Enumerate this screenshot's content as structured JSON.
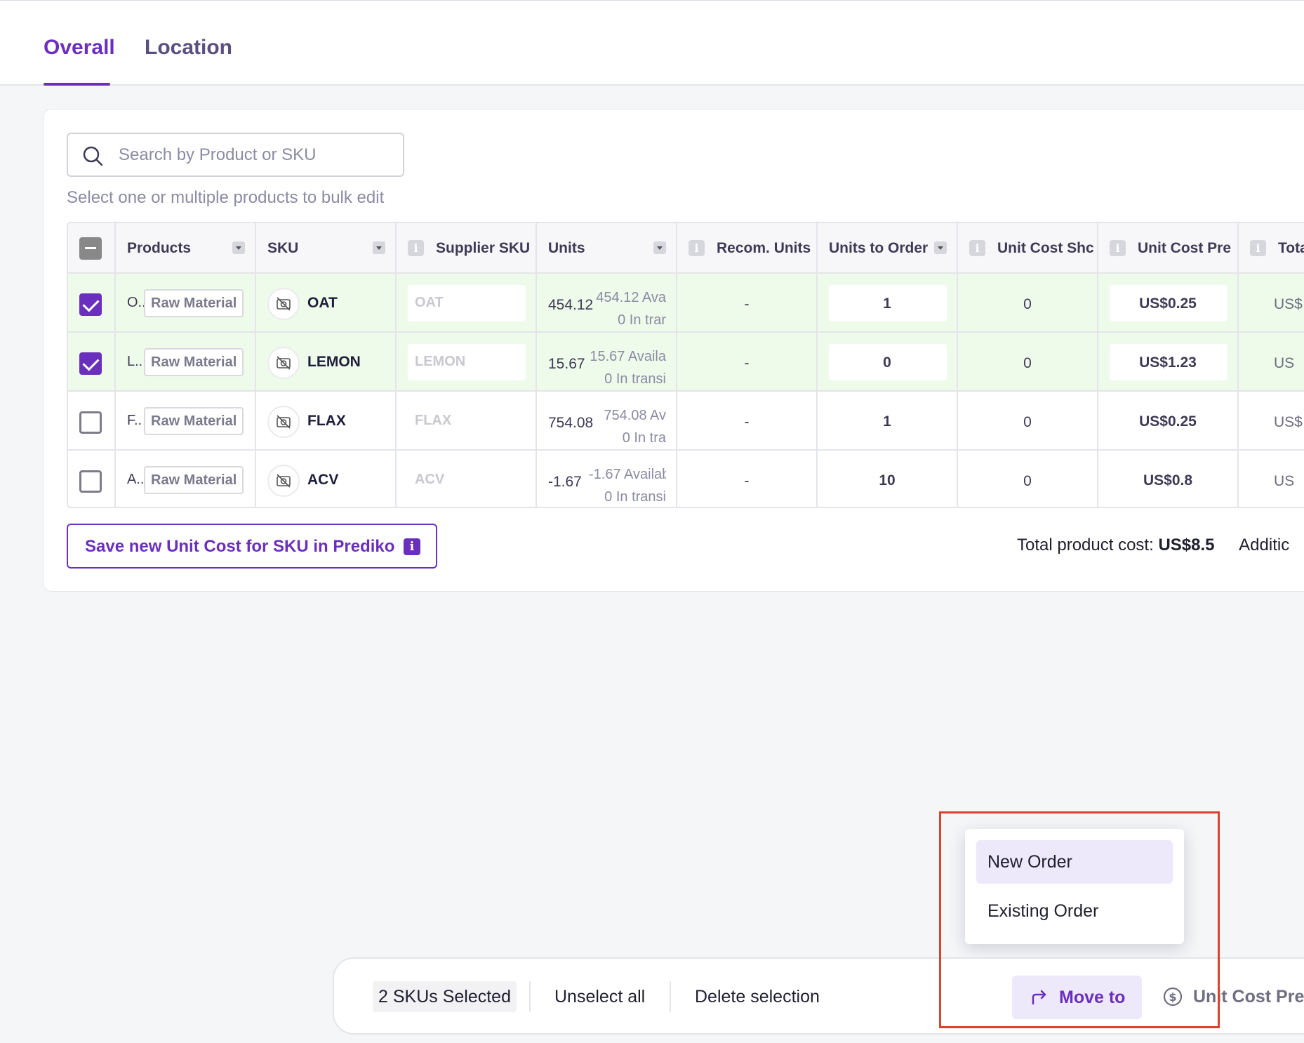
{
  "tabs": [
    {
      "label": "Overall",
      "active": true
    },
    {
      "label": "Location",
      "active": false
    }
  ],
  "search": {
    "placeholder": "Search by Product or SKU"
  },
  "hint": "Select one or multiple products to bulk edit",
  "columns": {
    "products": "Products",
    "sku": "SKU",
    "supplier_sku": "Supplier SKU",
    "units": "Units",
    "recom_units": "Recom. Units",
    "units_to_order": "Units to Order",
    "unit_cost_shopify": "Unit Cost Shc",
    "unit_cost_prediko": "Unit Cost Pre",
    "total": "Tota"
  },
  "rows": [
    {
      "selected": true,
      "initial": "O..",
      "tag": "Raw Material",
      "sku": "OAT",
      "supplier_sku": "OAT",
      "units": "454.12",
      "available": "454.12 Ava",
      "in_transit": "0 In trar",
      "recom": "-",
      "to_order": "1",
      "cost_shopify": "0",
      "cost_prediko": "US$0.25",
      "total": "US$"
    },
    {
      "selected": true,
      "initial": "L..",
      "tag": "Raw Material",
      "sku": "LEMON",
      "supplier_sku": "LEMON",
      "units": "15.67",
      "available": "15.67 Availa",
      "in_transit": "0 In transi",
      "recom": "-",
      "to_order": "0",
      "cost_shopify": "0",
      "cost_prediko": "US$1.23",
      "total": "US"
    },
    {
      "selected": false,
      "initial": "F..",
      "tag": "Raw Material",
      "sku": "FLAX",
      "supplier_sku": "FLAX",
      "units": "754.08",
      "available": "754.08 Av",
      "in_transit": "0 In tra",
      "recom": "-",
      "to_order": "1",
      "cost_shopify": "0",
      "cost_prediko": "US$0.25",
      "total": "US$"
    },
    {
      "selected": false,
      "initial": "A..",
      "tag": "Raw Material",
      "sku": "ACV",
      "supplier_sku": "ACV",
      "units": "-1.67",
      "available": "-1.67 Availab",
      "in_transit": "0 In transi",
      "recom": "-",
      "to_order": "10",
      "cost_shopify": "0",
      "cost_prediko": "US$0.8",
      "total": "US"
    }
  ],
  "save_button": {
    "label": "Save new Unit Cost for SKU in Prediko",
    "icon": "info-icon"
  },
  "totals": {
    "label": "Total product cost:",
    "value": "US$8.5",
    "additional": "Additic"
  },
  "bottom_bar": {
    "selected_count": "2 SKUs Selected",
    "unselect_all": "Unselect all",
    "delete_selection": "Delete selection",
    "move_to": "Move to",
    "unit_cost_pred": "Unit Cost Pred"
  },
  "dropdown": {
    "items": [
      {
        "label": "New Order",
        "highlighted": true
      },
      {
        "label": "Existing Order",
        "highlighted": false
      }
    ]
  },
  "colors": {
    "accent": "#6b2fbd",
    "selected_row": "#eefbea",
    "highlight_box": "#d9432f"
  }
}
